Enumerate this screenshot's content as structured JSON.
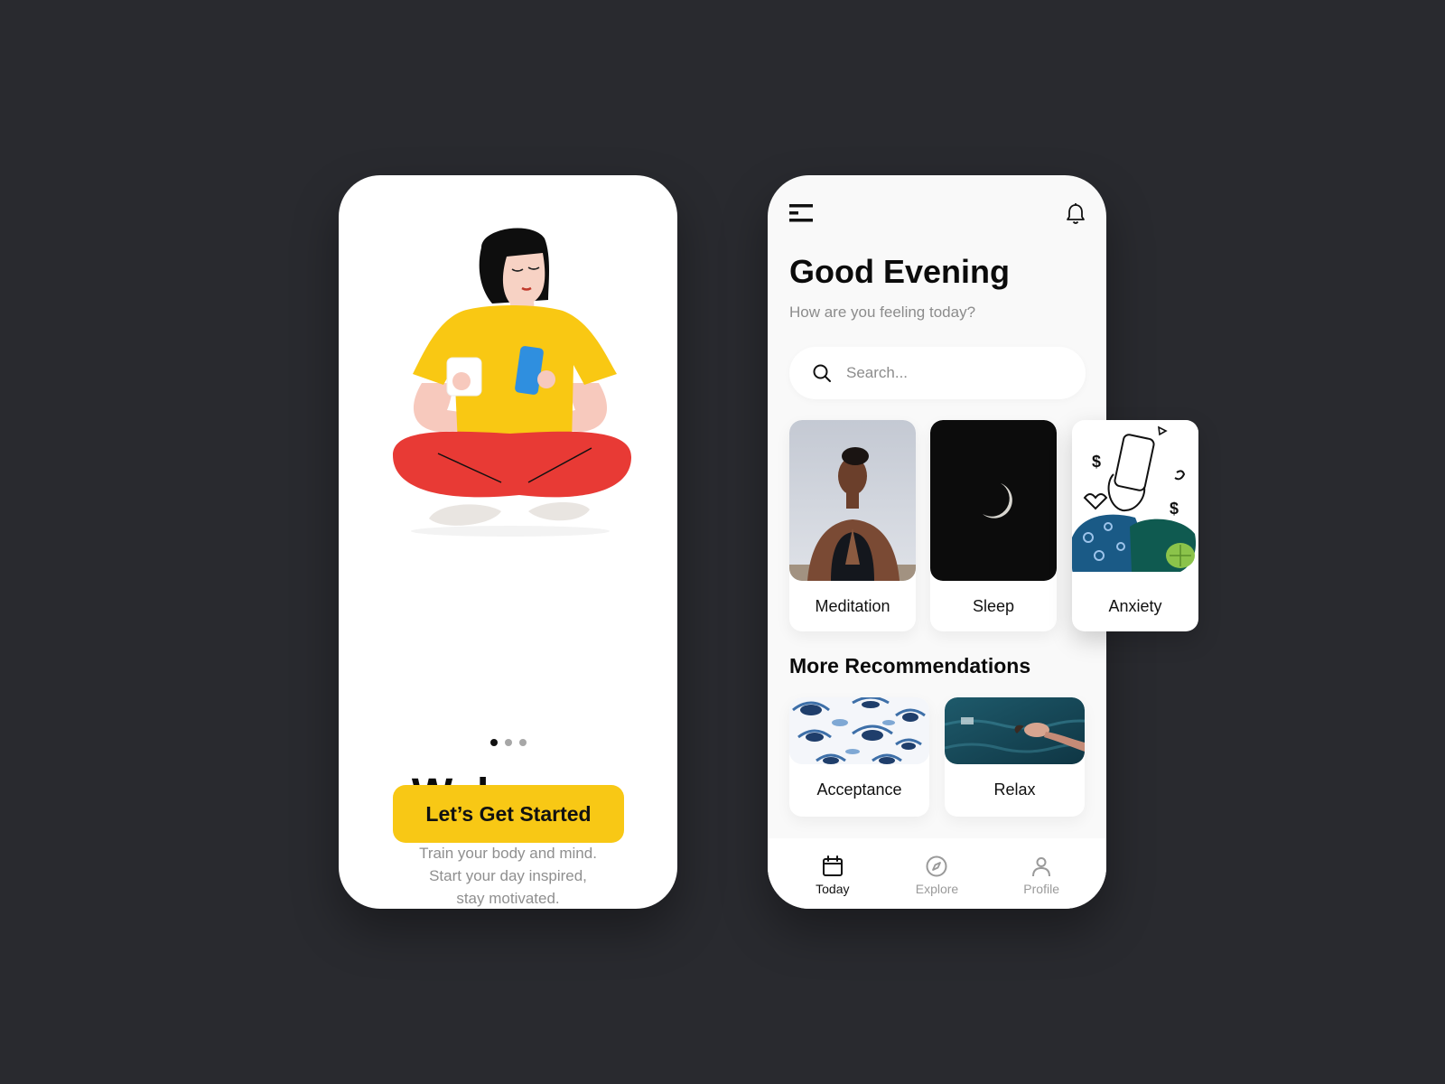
{
  "welcome": {
    "title": "Welcome",
    "description_lines": [
      "Train your body and mind.",
      "Start your day inspired,",
      "stay motivated."
    ],
    "cta_label": "Let’s Get Started",
    "pager": {
      "count": 3,
      "active": 0
    }
  },
  "home": {
    "greeting": "Good Evening",
    "subgreeting": "How are you feeling today?",
    "search": {
      "placeholder": "Search..."
    },
    "categories": [
      {
        "label": "Meditation"
      },
      {
        "label": "Sleep"
      },
      {
        "label": "Anxiety"
      }
    ],
    "recommendations_title": "More Recommendations",
    "recommendations": [
      {
        "label": "Acceptance"
      },
      {
        "label": "Relax"
      }
    ],
    "tabs": [
      {
        "label": "Today",
        "icon": "calendar-icon",
        "active": true
      },
      {
        "label": "Explore",
        "icon": "compass-icon",
        "active": false
      },
      {
        "label": "Profile",
        "icon": "user-icon",
        "active": false
      }
    ]
  },
  "colors": {
    "background": "#292a2f",
    "accent_yellow": "#f8c815",
    "text_dark": "#0b0b0b",
    "text_muted": "#8c8c8c"
  }
}
